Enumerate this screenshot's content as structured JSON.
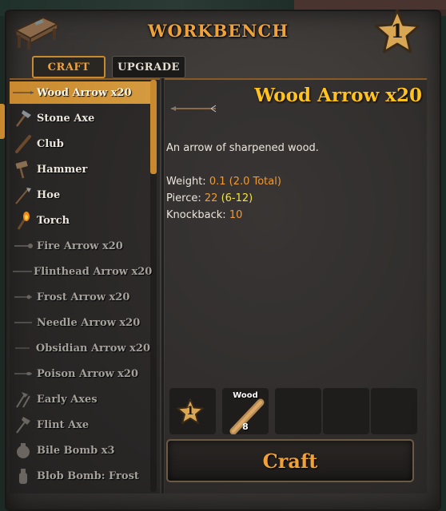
{
  "header": {
    "title": "WORKBENCH",
    "station_level": "1"
  },
  "tabs": [
    {
      "label": "CRAFT",
      "active": true
    },
    {
      "label": "UPGRADE",
      "active": false
    }
  ],
  "recipes": [
    {
      "label": "Wood Arrow x20",
      "icon": "wood-arrow-icon",
      "state": "selected"
    },
    {
      "label": "Stone Axe",
      "icon": "stone-axe-icon",
      "state": "available"
    },
    {
      "label": "Club",
      "icon": "club-icon",
      "state": "available"
    },
    {
      "label": "Hammer",
      "icon": "hammer-icon",
      "state": "available"
    },
    {
      "label": "Hoe",
      "icon": "hoe-icon",
      "state": "available"
    },
    {
      "label": "Torch",
      "icon": "torch-icon",
      "state": "available"
    },
    {
      "label": "Fire Arrow x20",
      "icon": "fire-arrow-icon",
      "state": "unavailable"
    },
    {
      "label": "Flinthead Arrow x20",
      "icon": "flinthead-arrow-icon",
      "state": "unavailable"
    },
    {
      "label": "Frost Arrow x20",
      "icon": "frost-arrow-icon",
      "state": "unavailable"
    },
    {
      "label": "Needle Arrow x20",
      "icon": "needle-arrow-icon",
      "state": "unavailable"
    },
    {
      "label": "Obsidian Arrow x20",
      "icon": "obsidian-arrow-icon",
      "state": "unavailable"
    },
    {
      "label": "Poison Arrow x20",
      "icon": "poison-arrow-icon",
      "state": "unavailable"
    },
    {
      "label": "Early Axes",
      "icon": "early-axes-icon",
      "state": "unavailable"
    },
    {
      "label": "Flint Axe",
      "icon": "flint-axe-icon",
      "state": "unavailable"
    },
    {
      "label": "Bile Bomb x3",
      "icon": "bile-bomb-icon",
      "state": "unavailable"
    },
    {
      "label": "Blob Bomb: Frost",
      "icon": "blob-bomb-icon",
      "state": "unavailable"
    }
  ],
  "detail": {
    "title": "Wood Arrow x20",
    "description": "An arrow of sharpened wood.",
    "weight_label": "Weight:",
    "weight_value": "0.1 (2.0 Total)",
    "pierce_label": "Pierce:",
    "pierce_value": "22",
    "pierce_range": "(6-12)",
    "knockback_label": "Knockback:",
    "knockback_value": "10"
  },
  "requirements": {
    "required_level": "1",
    "resource_name": "Wood",
    "resource_amount": "8"
  },
  "craft_button": "Craft",
  "colors": {
    "accent": "#c98a2f",
    "title": "#ffc21e",
    "stat_value": "#f29a2e",
    "stat_range": "#f5e23a"
  }
}
